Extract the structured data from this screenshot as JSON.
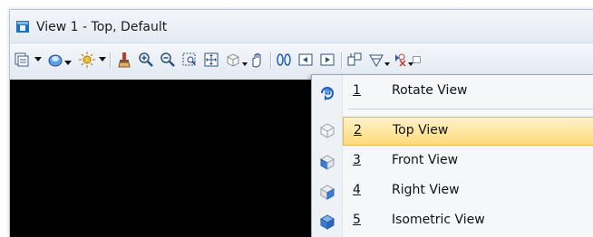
{
  "window": {
    "title": "View 1 - Top, Default"
  },
  "toolbar": {
    "icons": [
      "view-attributes-icon",
      "dropdown-arrow-icon",
      "view-display-icon",
      "dropdown-arrow-icon",
      "lighting-icon",
      "dropdown-arrow-icon",
      "update-view-icon",
      "zoom-in-icon",
      "zoom-out-icon",
      "window-area-icon",
      "fit-view-icon",
      "rotate-view-icon",
      "pan-view-icon",
      "walk-icon",
      "previous-view-icon",
      "next-view-icon",
      "view-tool-icon",
      "clip-volume-icon",
      "camera-icon",
      "more-icon"
    ]
  },
  "menu": {
    "items": [
      {
        "number": "1",
        "label": "Rotate View",
        "icon": "rotate-view-icon"
      },
      {
        "number": "2",
        "label": "Top View",
        "icon": "top-view-cube-icon",
        "highlighted": true
      },
      {
        "number": "3",
        "label": "Front View",
        "icon": "front-view-cube-icon"
      },
      {
        "number": "4",
        "label": "Right View",
        "icon": "right-view-cube-icon"
      },
      {
        "number": "5",
        "label": "Isometric View",
        "icon": "isometric-view-cube-icon"
      }
    ]
  },
  "colors": {
    "viewport": "#000000",
    "highlight_top": "#fff3c9",
    "highlight_bottom": "#ffd97a",
    "cube_blue": "#3a7fd5"
  }
}
